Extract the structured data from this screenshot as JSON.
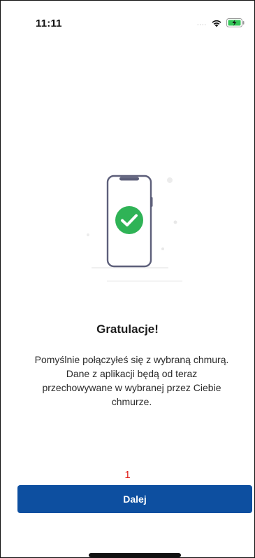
{
  "status_bar": {
    "time": "11:11",
    "signal": "....",
    "wifi_icon": "wifi-icon",
    "battery_icon": "battery-charging-icon"
  },
  "illustration": {
    "icon": "phone-checkmark-icon",
    "check_color": "#2fb356"
  },
  "content": {
    "title": "Gratulacje!",
    "message_line1": "Pomyślnie połączyłeś się z wybraną chmurą.",
    "message_line2": "Dane z aplikacji będą od teraz",
    "message_line3": "przechowywane w wybranej przez Ciebie",
    "message_line4": "chmurze."
  },
  "footer": {
    "step_marker": "1",
    "next_label": "Dalej"
  },
  "colors": {
    "primary": "#0d4fa0",
    "success": "#2fb356",
    "marker": "#e0201a"
  }
}
